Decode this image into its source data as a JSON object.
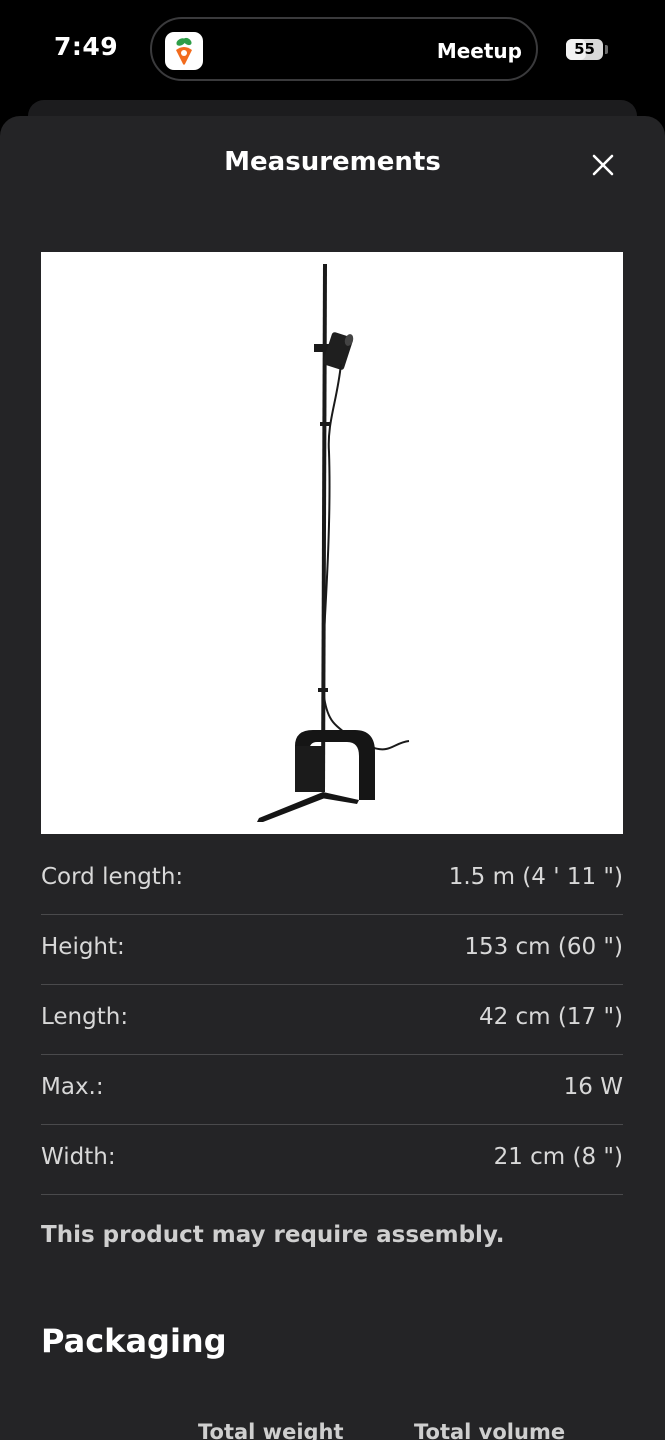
{
  "status_bar": {
    "time": "7:49",
    "live_activity_label": "Meetup",
    "live_activity_icon": "carrot-app-icon",
    "battery_level": "55"
  },
  "sheet": {
    "title": "Measurements",
    "close_icon": "close-icon"
  },
  "product_image": {
    "subject": "floor-lamp"
  },
  "specs": [
    {
      "label": "Cord length:",
      "value": "1.5 m (4 ' 11 \")"
    },
    {
      "label": "Height:",
      "value": "153 cm (60 \")"
    },
    {
      "label": "Length:",
      "value": "42 cm (17 \")"
    },
    {
      "label": "Max.:",
      "value": "16 W"
    },
    {
      "label": "Width:",
      "value": "21 cm (8 \")"
    }
  ],
  "assembly_note": "This product may require assembly.",
  "packaging": {
    "heading": "Packaging",
    "columns": [
      "Total weight",
      "Total volume"
    ]
  },
  "colors": {
    "background": "#000000",
    "sheet": "#242426",
    "divider": "#4a4a4c",
    "app_icon_orange": "#f26b1d",
    "app_icon_green": "#2e9e48"
  }
}
